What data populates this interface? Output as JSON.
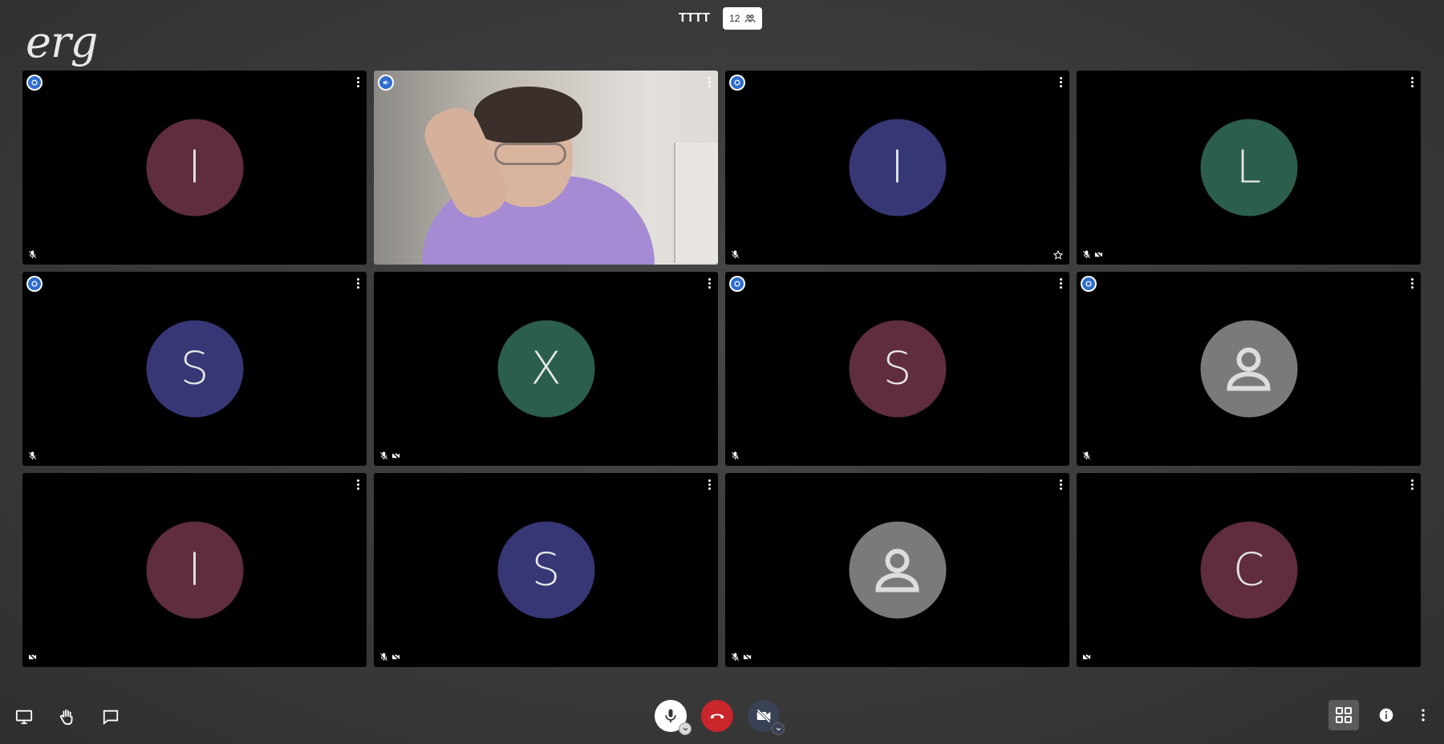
{
  "header": {
    "logo_text": "erg",
    "room_name": "TTTT",
    "participant_count": "12"
  },
  "colors": {
    "maroon": "#5f2d3f",
    "indigo": "#373775",
    "green": "#2b5f4b",
    "gray": "#7a7a7a",
    "active_border": "#2f6dd0",
    "hangup": "#c8262b"
  },
  "tiles": [
    {
      "initial": "I",
      "color": "maroon",
      "badge": "moderator",
      "muted": true,
      "video_off": false,
      "star": false
    },
    {
      "initial": "",
      "color": "video",
      "badge": "speaker",
      "muted": false,
      "video_off": false,
      "star": false,
      "active": true
    },
    {
      "initial": "I",
      "color": "indigo",
      "badge": "moderator",
      "muted": true,
      "video_off": false,
      "star": true
    },
    {
      "initial": "L",
      "color": "green",
      "badge": "",
      "muted": true,
      "video_off": true,
      "star": false
    },
    {
      "initial": "S",
      "color": "indigo",
      "badge": "moderator",
      "muted": true,
      "video_off": false,
      "star": false
    },
    {
      "initial": "X",
      "color": "green",
      "badge": "",
      "muted": true,
      "video_off": true,
      "star": false
    },
    {
      "initial": "S",
      "color": "maroon",
      "badge": "moderator",
      "muted": true,
      "video_off": false,
      "star": false
    },
    {
      "initial": "",
      "color": "gray",
      "badge": "moderator",
      "muted": true,
      "video_off": false,
      "star": false,
      "default_avatar": true
    },
    {
      "initial": "I",
      "color": "maroon",
      "badge": "",
      "muted": false,
      "video_off": true,
      "star": false
    },
    {
      "initial": "S",
      "color": "indigo",
      "badge": "",
      "muted": true,
      "video_off": true,
      "star": false
    },
    {
      "initial": "",
      "color": "gray",
      "badge": "",
      "muted": true,
      "video_off": true,
      "star": false,
      "default_avatar": true
    },
    {
      "initial": "C",
      "color": "maroon",
      "badge": "",
      "muted": false,
      "video_off": true,
      "star": false
    }
  ],
  "toolbar": {
    "left": [
      "screen-share-icon",
      "raise-hand-icon",
      "chat-icon"
    ],
    "center": [
      "microphone-icon",
      "hangup-icon",
      "camera-off-icon"
    ],
    "right": [
      "tile-view-icon",
      "info-icon",
      "more-options-icon"
    ]
  }
}
